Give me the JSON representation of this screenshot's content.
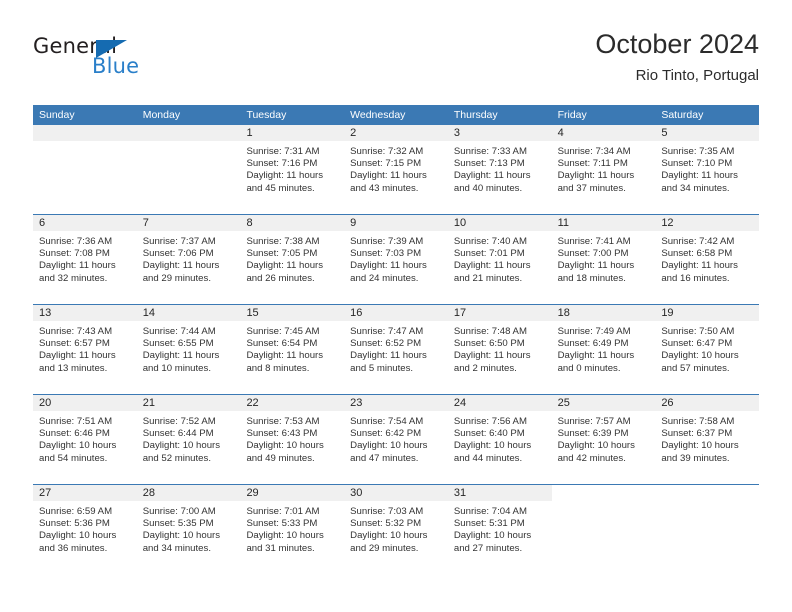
{
  "brand": {
    "name_top": "General",
    "name_bottom": "Blue",
    "accent_color": "#2a7fc9",
    "triangle_color": "#156bb1"
  },
  "header": {
    "title": "October 2024",
    "subtitle": "Rio Tinto, Portugal"
  },
  "theme": {
    "header_bg": "#3b79b4",
    "daynum_bg": "#f0f0f0",
    "cell_bg": "#ffffff",
    "text_color": "#333333"
  },
  "weekdays": [
    "Sunday",
    "Monday",
    "Tuesday",
    "Wednesday",
    "Thursday",
    "Friday",
    "Saturday"
  ],
  "weeks": [
    [
      {
        "day": "",
        "sunrise": "",
        "sunset": "",
        "daylight1": "",
        "daylight2": ""
      },
      {
        "day": "",
        "sunrise": "",
        "sunset": "",
        "daylight1": "",
        "daylight2": ""
      },
      {
        "day": "1",
        "sunrise": "Sunrise: 7:31 AM",
        "sunset": "Sunset: 7:16 PM",
        "daylight1": "Daylight: 11 hours",
        "daylight2": "and 45 minutes."
      },
      {
        "day": "2",
        "sunrise": "Sunrise: 7:32 AM",
        "sunset": "Sunset: 7:15 PM",
        "daylight1": "Daylight: 11 hours",
        "daylight2": "and 43 minutes."
      },
      {
        "day": "3",
        "sunrise": "Sunrise: 7:33 AM",
        "sunset": "Sunset: 7:13 PM",
        "daylight1": "Daylight: 11 hours",
        "daylight2": "and 40 minutes."
      },
      {
        "day": "4",
        "sunrise": "Sunrise: 7:34 AM",
        "sunset": "Sunset: 7:11 PM",
        "daylight1": "Daylight: 11 hours",
        "daylight2": "and 37 minutes."
      },
      {
        "day": "5",
        "sunrise": "Sunrise: 7:35 AM",
        "sunset": "Sunset: 7:10 PM",
        "daylight1": "Daylight: 11 hours",
        "daylight2": "and 34 minutes."
      }
    ],
    [
      {
        "day": "6",
        "sunrise": "Sunrise: 7:36 AM",
        "sunset": "Sunset: 7:08 PM",
        "daylight1": "Daylight: 11 hours",
        "daylight2": "and 32 minutes."
      },
      {
        "day": "7",
        "sunrise": "Sunrise: 7:37 AM",
        "sunset": "Sunset: 7:06 PM",
        "daylight1": "Daylight: 11 hours",
        "daylight2": "and 29 minutes."
      },
      {
        "day": "8",
        "sunrise": "Sunrise: 7:38 AM",
        "sunset": "Sunset: 7:05 PM",
        "daylight1": "Daylight: 11 hours",
        "daylight2": "and 26 minutes."
      },
      {
        "day": "9",
        "sunrise": "Sunrise: 7:39 AM",
        "sunset": "Sunset: 7:03 PM",
        "daylight1": "Daylight: 11 hours",
        "daylight2": "and 24 minutes."
      },
      {
        "day": "10",
        "sunrise": "Sunrise: 7:40 AM",
        "sunset": "Sunset: 7:01 PM",
        "daylight1": "Daylight: 11 hours",
        "daylight2": "and 21 minutes."
      },
      {
        "day": "11",
        "sunrise": "Sunrise: 7:41 AM",
        "sunset": "Sunset: 7:00 PM",
        "daylight1": "Daylight: 11 hours",
        "daylight2": "and 18 minutes."
      },
      {
        "day": "12",
        "sunrise": "Sunrise: 7:42 AM",
        "sunset": "Sunset: 6:58 PM",
        "daylight1": "Daylight: 11 hours",
        "daylight2": "and 16 minutes."
      }
    ],
    [
      {
        "day": "13",
        "sunrise": "Sunrise: 7:43 AM",
        "sunset": "Sunset: 6:57 PM",
        "daylight1": "Daylight: 11 hours",
        "daylight2": "and 13 minutes."
      },
      {
        "day": "14",
        "sunrise": "Sunrise: 7:44 AM",
        "sunset": "Sunset: 6:55 PM",
        "daylight1": "Daylight: 11 hours",
        "daylight2": "and 10 minutes."
      },
      {
        "day": "15",
        "sunrise": "Sunrise: 7:45 AM",
        "sunset": "Sunset: 6:54 PM",
        "daylight1": "Daylight: 11 hours",
        "daylight2": "and 8 minutes."
      },
      {
        "day": "16",
        "sunrise": "Sunrise: 7:47 AM",
        "sunset": "Sunset: 6:52 PM",
        "daylight1": "Daylight: 11 hours",
        "daylight2": "and 5 minutes."
      },
      {
        "day": "17",
        "sunrise": "Sunrise: 7:48 AM",
        "sunset": "Sunset: 6:50 PM",
        "daylight1": "Daylight: 11 hours",
        "daylight2": "and 2 minutes."
      },
      {
        "day": "18",
        "sunrise": "Sunrise: 7:49 AM",
        "sunset": "Sunset: 6:49 PM",
        "daylight1": "Daylight: 11 hours",
        "daylight2": "and 0 minutes."
      },
      {
        "day": "19",
        "sunrise": "Sunrise: 7:50 AM",
        "sunset": "Sunset: 6:47 PM",
        "daylight1": "Daylight: 10 hours",
        "daylight2": "and 57 minutes."
      }
    ],
    [
      {
        "day": "20",
        "sunrise": "Sunrise: 7:51 AM",
        "sunset": "Sunset: 6:46 PM",
        "daylight1": "Daylight: 10 hours",
        "daylight2": "and 54 minutes."
      },
      {
        "day": "21",
        "sunrise": "Sunrise: 7:52 AM",
        "sunset": "Sunset: 6:44 PM",
        "daylight1": "Daylight: 10 hours",
        "daylight2": "and 52 minutes."
      },
      {
        "day": "22",
        "sunrise": "Sunrise: 7:53 AM",
        "sunset": "Sunset: 6:43 PM",
        "daylight1": "Daylight: 10 hours",
        "daylight2": "and 49 minutes."
      },
      {
        "day": "23",
        "sunrise": "Sunrise: 7:54 AM",
        "sunset": "Sunset: 6:42 PM",
        "daylight1": "Daylight: 10 hours",
        "daylight2": "and 47 minutes."
      },
      {
        "day": "24",
        "sunrise": "Sunrise: 7:56 AM",
        "sunset": "Sunset: 6:40 PM",
        "daylight1": "Daylight: 10 hours",
        "daylight2": "and 44 minutes."
      },
      {
        "day": "25",
        "sunrise": "Sunrise: 7:57 AM",
        "sunset": "Sunset: 6:39 PM",
        "daylight1": "Daylight: 10 hours",
        "daylight2": "and 42 minutes."
      },
      {
        "day": "26",
        "sunrise": "Sunrise: 7:58 AM",
        "sunset": "Sunset: 6:37 PM",
        "daylight1": "Daylight: 10 hours",
        "daylight2": "and 39 minutes."
      }
    ],
    [
      {
        "day": "27",
        "sunrise": "Sunrise: 6:59 AM",
        "sunset": "Sunset: 5:36 PM",
        "daylight1": "Daylight: 10 hours",
        "daylight2": "and 36 minutes."
      },
      {
        "day": "28",
        "sunrise": "Sunrise: 7:00 AM",
        "sunset": "Sunset: 5:35 PM",
        "daylight1": "Daylight: 10 hours",
        "daylight2": "and 34 minutes."
      },
      {
        "day": "29",
        "sunrise": "Sunrise: 7:01 AM",
        "sunset": "Sunset: 5:33 PM",
        "daylight1": "Daylight: 10 hours",
        "daylight2": "and 31 minutes."
      },
      {
        "day": "30",
        "sunrise": "Sunrise: 7:03 AM",
        "sunset": "Sunset: 5:32 PM",
        "daylight1": "Daylight: 10 hours",
        "daylight2": "and 29 minutes."
      },
      {
        "day": "31",
        "sunrise": "Sunrise: 7:04 AM",
        "sunset": "Sunset: 5:31 PM",
        "daylight1": "Daylight: 10 hours",
        "daylight2": "and 27 minutes."
      },
      {
        "day": "",
        "sunrise": "",
        "sunset": "",
        "daylight1": "",
        "daylight2": ""
      },
      {
        "day": "",
        "sunrise": "",
        "sunset": "",
        "daylight1": "",
        "daylight2": ""
      }
    ]
  ]
}
